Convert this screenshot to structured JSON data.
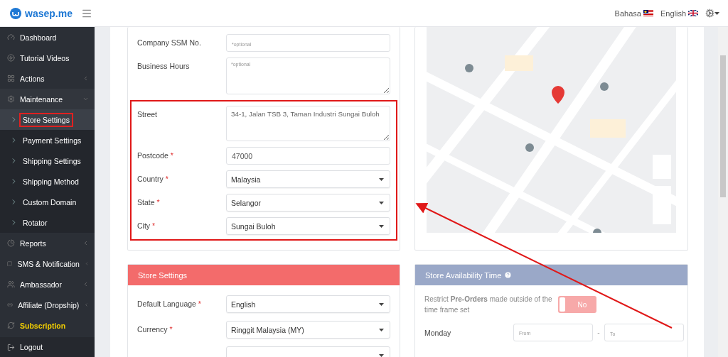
{
  "topbar": {
    "logo": "wasep.me",
    "languages": [
      {
        "label": "Bahasa"
      },
      {
        "label": "English"
      }
    ]
  },
  "sidebar": {
    "items": [
      {
        "label": "Dashboard",
        "kind": "link",
        "selected": false,
        "highlighted": false
      },
      {
        "label": "Tutorial Videos",
        "kind": "link",
        "selected": false,
        "highlighted": false
      },
      {
        "label": "Actions",
        "kind": "group",
        "expanded": false,
        "selected": false,
        "highlighted": false
      },
      {
        "label": "Maintenance",
        "kind": "group",
        "expanded": true,
        "selected": false,
        "highlighted": false
      },
      {
        "label": "Store Settings",
        "kind": "sub",
        "selected": true,
        "highlighted": false
      },
      {
        "label": "Payment Settings",
        "kind": "sub",
        "selected": false,
        "highlighted": false
      },
      {
        "label": "Shipping Settings",
        "kind": "sub",
        "selected": false,
        "highlighted": false
      },
      {
        "label": "Shipping Method",
        "kind": "sub",
        "selected": false,
        "highlighted": false
      },
      {
        "label": "Custom Domain",
        "kind": "sub",
        "selected": false,
        "highlighted": false
      },
      {
        "label": "Rotator",
        "kind": "sub",
        "selected": false,
        "highlighted": false
      },
      {
        "label": "Reports",
        "kind": "group",
        "expanded": false,
        "selected": false,
        "highlighted": false
      },
      {
        "label": "SMS & Notification",
        "kind": "group",
        "expanded": false,
        "selected": false,
        "highlighted": false
      },
      {
        "label": "Ambassador",
        "kind": "group",
        "expanded": false,
        "selected": false,
        "highlighted": false
      },
      {
        "label": "Affiliate (Dropship)",
        "kind": "group",
        "expanded": false,
        "selected": false,
        "highlighted": false
      },
      {
        "label": "Subscription",
        "kind": "link",
        "selected": false,
        "highlighted": true
      }
    ],
    "footer": "Logout"
  },
  "address_form": {
    "fields": [
      {
        "label": "Company SSM No.",
        "kind": "input",
        "placeholder": "*optional"
      },
      {
        "label": "Business Hours",
        "kind": "textarea",
        "placeholder": "*optional"
      }
    ],
    "highlighted_fields": [
      {
        "label": "Street",
        "kind": "textarea",
        "value": "34-1, Jalan TSB 3, Taman Industri Sungai Buloh"
      },
      {
        "label": "Postcode",
        "kind": "input",
        "required_mark": "*",
        "value": "47000"
      },
      {
        "label": "Country",
        "kind": "select",
        "required_mark": "*",
        "value": "Malaysia"
      },
      {
        "label": "State",
        "kind": "select",
        "required_mark": "*",
        "value": "Selangor"
      },
      {
        "label": "City",
        "kind": "select",
        "required_mark": "*",
        "value": "Sungai Buloh"
      }
    ]
  },
  "store_settings": {
    "title": "Store Settings",
    "fields": [
      {
        "label": "Default Language",
        "kind": "select",
        "required_mark": "*",
        "value": "English"
      },
      {
        "label": "Currency",
        "kind": "select",
        "required_mark": "*",
        "value": "Ringgit Malaysia (MY)"
      },
      {
        "kind": "select"
      }
    ]
  },
  "store_availability": {
    "title": "Store Availability Time",
    "restrict_text": "Restrict **Pre-Orders** made outside of the time frame set",
    "restrict_toggle": {
      "label": "No",
      "on": false
    },
    "days": [
      {
        "label": "Monday",
        "from_placeholder": "From",
        "separator": "-",
        "to_placeholder": "To"
      }
    ]
  }
}
